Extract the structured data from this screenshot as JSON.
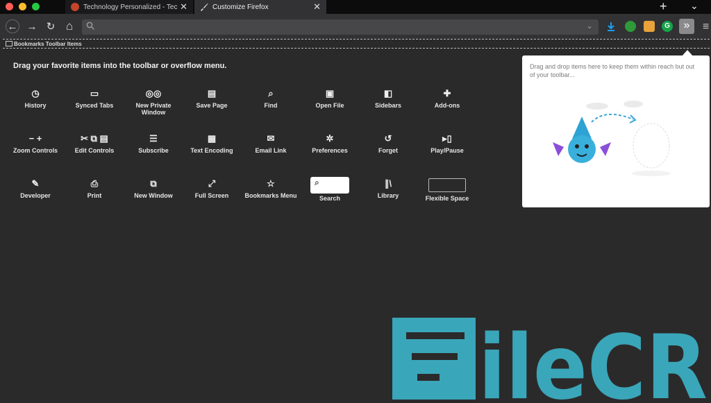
{
  "window": {
    "traffic_lights": [
      "#ff5f57",
      "#ffbd2e",
      "#28c840"
    ]
  },
  "tabs": [
    {
      "title": "Technology Personalized - Tec",
      "icon": "site-favicon",
      "close": "✕",
      "active": false
    },
    {
      "title": "Customize Firefox",
      "icon": "paintbrush-icon",
      "close": "✕",
      "active": true
    }
  ],
  "tabbar": {
    "new_tab": "+",
    "overflow": "⌄"
  },
  "toolbar": {
    "back": "←",
    "forward": "→",
    "reload": "↻",
    "home": "⌂",
    "url_value": "",
    "url_icon": "search-icon",
    "overflow_label": "»",
    "menu_label": "≡",
    "extensions": [
      {
        "name": "download-icon",
        "color": "#1a9ff0"
      },
      {
        "name": "extension-green-icon",
        "color": "#2e9a3a"
      },
      {
        "name": "extension-orange-icon",
        "color": "#e8a33a"
      },
      {
        "name": "grammarly-icon",
        "color": "#16a34a"
      }
    ]
  },
  "bookmarks_toolbar": {
    "label": "Bookmarks Toolbar Items"
  },
  "customize": {
    "heading": "Drag your favorite items into the toolbar or overflow menu.",
    "items": [
      {
        "label": "History",
        "icon": "◷",
        "icon_name": "history-icon"
      },
      {
        "label": "Synced Tabs",
        "icon": "▭",
        "icon_name": "synced-tabs-icon"
      },
      {
        "label": "New Private Window",
        "icon": "◎◎",
        "icon_name": "private-window-icon"
      },
      {
        "label": "Save Page",
        "icon": "▤",
        "icon_name": "save-page-icon"
      },
      {
        "label": "Find",
        "icon": "⌕",
        "icon_name": "find-icon"
      },
      {
        "label": "Open File",
        "icon": "▣",
        "icon_name": "open-file-icon"
      },
      {
        "label": "Sidebars",
        "icon": "◧",
        "icon_name": "sidebars-icon"
      },
      {
        "label": "Add-ons",
        "icon": "✚",
        "icon_name": "addons-icon"
      },
      {
        "label": "Zoom Controls",
        "icon": "− +",
        "icon_name": "zoom-controls-icon"
      },
      {
        "label": "Edit Controls",
        "icon": "✂ ⧉ ▤",
        "icon_name": "edit-controls-icon"
      },
      {
        "label": "Subscribe",
        "icon": "☰",
        "icon_name": "subscribe-icon"
      },
      {
        "label": "Text Encoding",
        "icon": "▦",
        "icon_name": "text-encoding-icon"
      },
      {
        "label": "Email Link",
        "icon": "✉",
        "icon_name": "email-link-icon"
      },
      {
        "label": "Preferences",
        "icon": "✲",
        "icon_name": "preferences-icon"
      },
      {
        "label": "Forget",
        "icon": "↺",
        "icon_name": "forget-icon"
      },
      {
        "label": "Play/Pause",
        "icon": "▸▯",
        "icon_name": "play-pause-icon"
      },
      {
        "label": "Developer",
        "icon": "✎",
        "icon_name": "developer-icon"
      },
      {
        "label": "Print",
        "icon": "⎙",
        "icon_name": "print-icon"
      },
      {
        "label": "New Window",
        "icon": "⧉",
        "icon_name": "new-window-icon"
      },
      {
        "label": "Full Screen",
        "icon": "⤢",
        "icon_name": "full-screen-icon"
      },
      {
        "label": "Bookmarks Menu",
        "icon": "☆",
        "icon_name": "bookmarks-menu-icon"
      },
      {
        "label": "Search",
        "icon": "⌕",
        "icon_name": "search-icon"
      },
      {
        "label": "Library",
        "icon": "∥\\",
        "icon_name": "library-icon"
      },
      {
        "label": "Flexible Space",
        "icon": "",
        "icon_name": "flexible-space-icon"
      }
    ]
  },
  "overflow_panel": {
    "text": "Drag and drop items here to keep them within reach but out of your toolbar...",
    "illustration": "firefox-dragon-illustration"
  },
  "watermark": {
    "text": "FileCR",
    "color": "#3aa6b9"
  }
}
